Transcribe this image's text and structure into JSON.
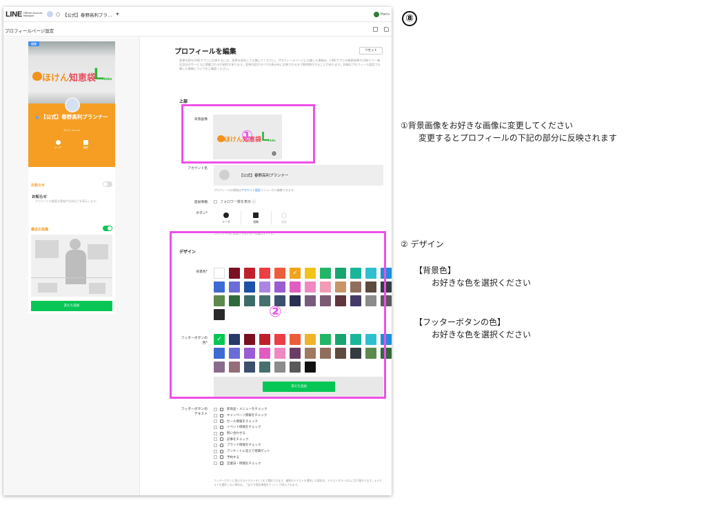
{
  "app": {
    "logo": "LINE",
    "logo_sub": "Official Account Manager",
    "account_name": "【公式】春野高利プラ…",
    "user_name": "Haru"
  },
  "page": {
    "title": "プロフィールページ設定"
  },
  "preview": {
    "edit_tag": "編集",
    "name": "【公式】春野高利プランナー",
    "id": "@123_abcdef",
    "btn_talk": "トーク",
    "btn_post": "投稿",
    "notice_head": "お知らせ",
    "notice_title": "お知らせ",
    "notice_desc": "アカウントの重要な情報や告知などを表示します。",
    "posts_head": "最近の投稿",
    "add_friend": "友だち追加",
    "logo_main": "ほけん",
    "logo_accent": "知恵袋",
    "logo_L": "L",
    "logo_links": "links"
  },
  "main": {
    "title": "プロフィールを編集",
    "reset": "リセット",
    "desc": "変更内容をLINEアプリに反映するには、変更を保存して公開してください。プロフィールページに公開した情報は、LINEアプリの検索結果やLINEヤフー株式会社のサービスに掲載される可能性があります。変更内容がすべての表示先に反映されるまで数時間かかることがあります。詳細はプロフィール設定で公開した情報についてをご確認ください。",
    "section_top": "上部",
    "bg_label": "背景画像",
    "name_label": "アカウント名",
    "name_value": "【公式】春野高利プランナー",
    "name_note_pre": "プロフィールの情報は",
    "name_note_link": "アカウント設定",
    "name_note_post": "メニューから編集できます。",
    "extra_label": "追加情報",
    "extra_option": "フォロワー数を表示 ⓘ",
    "buttons_label": "ボタン*",
    "btn_talk": "トーク",
    "btn_post": "投稿",
    "btn_add": "追加",
    "btn_note": "プロフィールに追加できるボタンは最大3つです。",
    "design_title": "デザイン",
    "bgcolor_label": "背景色*",
    "footer_color_label": "フッターボタンの色*",
    "footer_add": "友だち追加",
    "footer_text_label": "フッターボタンのテキスト",
    "footer_texts": [
      "新商品・メニューをチェック",
      "キャンペーン情報をチェック",
      "セール情報をチェック",
      "イベント情報をチェック",
      "問い合わせる",
      "記事をチェック",
      "ブランド情報をチェック",
      "アンケートに答えて特典ゲット",
      "予約する",
      "営業日・時間をチェック"
    ],
    "footer_text_note": "フッターボタンに表示するテキストを1つまで選択できます。複数のテキストを選択した場合は、テキストがランダムに切り替わります。※テキストを選択しない場合は、「友だち限定情報をゲット」が表示されます。"
  },
  "colors": {
    "bg": [
      "#ffffff",
      "#7a1020",
      "#c0202c",
      "#ea3f45",
      "#ee5d3a",
      "#f0a31a",
      "#f3c31a",
      "#22b565",
      "#17a572",
      "#18b79a",
      "#2fc0cf",
      "#1e8ed8",
      "#3d6ad3",
      "#6a6cd8",
      "#1e52a6",
      "#a985e4",
      "#9a5bd3",
      "#e15cc0",
      "#f089c2",
      "#f29bb4",
      "#c9946a",
      "#906e5d",
      "#5e4a3e",
      "#343c42",
      "#5b8a4a",
      "#2f6b3a",
      "#3d6b68",
      "#46706e",
      "#3c506e",
      "#2a2e52",
      "#775a7e",
      "#7a5b74",
      "#60363c",
      "#463a69",
      "#8c8c8c",
      "#5a5a5a",
      "#2a2a2a"
    ],
    "bg_selected": 5,
    "footer": [
      "#06c755",
      "#273a6a",
      "#7a1020",
      "#c0202c",
      "#ea3f45",
      "#ee5d3a",
      "#f0b42a",
      "#22b565",
      "#17a572",
      "#18b79a",
      "#2fc0cf",
      "#1e8ed8",
      "#3d6ad3",
      "#6a6cd8",
      "#9a5bd3",
      "#e15cc0",
      "#f089c2",
      "#6b3d66",
      "#a07a5f",
      "#906e5d",
      "#5e4a3e",
      "#343c42",
      "#5b8a4a",
      "#2f6b3a",
      "#8a6a8a",
      "#946e7a",
      "#3c506e",
      "#46706e",
      "#8c8c8c",
      "#5a5a5a",
      "#111111"
    ],
    "footer_selected": 0
  },
  "annotations": {
    "badge": "⑧",
    "mark1": "①",
    "mark2": "②",
    "note1_line1": "①背景画像をお好きな画像に変更してください",
    "note1_line2": "変更するとプロフィールの下記の部分に反映されます",
    "note2": "② デザイン",
    "note3_head": "【背景色】",
    "note3_body": "お好きな色を選択ください",
    "note4_head": "【フッターボタンの色】",
    "note4_body": "お好きな色を選択ください"
  }
}
